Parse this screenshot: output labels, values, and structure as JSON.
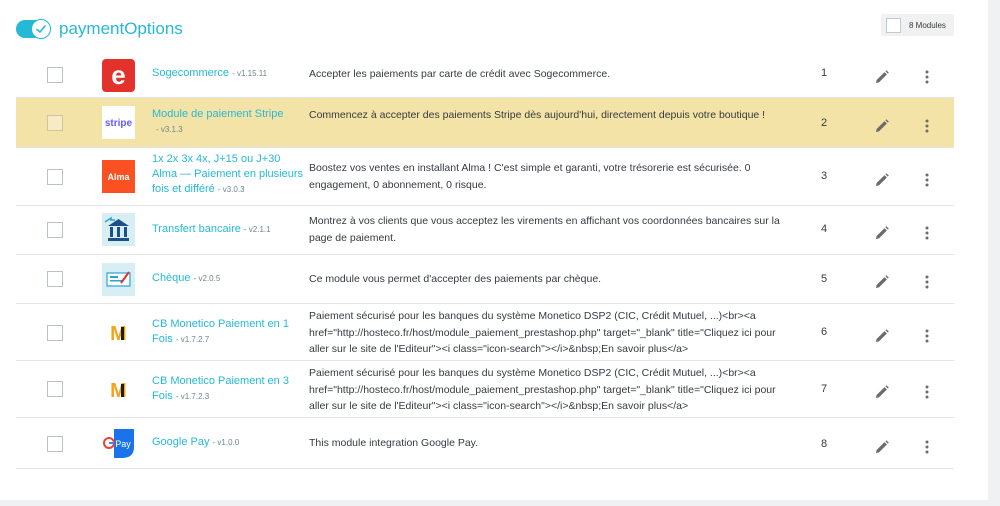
{
  "hook": {
    "title": "paymentOptions",
    "modules_count_label": "8 Modules",
    "toggle_on": true,
    "accent_color": "#25b9d7"
  },
  "modules": [
    {
      "name": "Sogecommerce",
      "version": "- v1.15.11",
      "description": "Accepter les paiements par carte de crédit avec Sogecommerce.",
      "position": "1",
      "logo": "sogecommerce-logo"
    },
    {
      "name": "Module de paiement Stripe",
      "version": "- v3.1.3",
      "description": "Commencez à accepter des paiements Stripe dès aujourd'hui, directement depuis votre boutique !",
      "position": "2",
      "logo": "stripe-logo",
      "logo_text": "stripe"
    },
    {
      "name": "1x 2x 3x 4x, J+15 ou J+30 Alma — Paiement en plusieurs fois et différé",
      "version": "- v3.0.3",
      "description": "Boostez vos ventes en installant Alma ! C'est simple et garanti, votre trésorerie est sécurisée. 0 engagement, 0 abonnement, 0 risque.",
      "position": "3",
      "logo": "alma-logo",
      "logo_text": "Alma"
    },
    {
      "name": "Transfert bancaire",
      "version": "- v2.1.1",
      "description": "Montrez à vos clients que vous acceptez les virements en affichant vos coordonnées bancaires sur la page de paiement.",
      "position": "4",
      "logo": "bank-transfer-logo"
    },
    {
      "name": "Chèque",
      "version": "- v2.0.5",
      "description": "Ce module vous permet d'accepter des paiements par chèque.",
      "position": "5",
      "logo": "cheque-logo"
    },
    {
      "name": "CB Monetico Paiement en 1 Fois",
      "version": "- v1.7.2.7",
      "description": "Paiement sécurisé pour les banques du système Monetico DSP2 (CIC, Crédit Mutuel, ...)<br><a href=\"http://hosteco.fr/host/module_paiement_prestashop.php\" target=\"_blank\" title=\"Cliquez ici pour aller sur le site de l'Editeur\"><i class=\"icon-search\"></i>&nbsp;En savoir plus</a>",
      "position": "6",
      "logo": "monetico-logo",
      "logo_text": "M"
    },
    {
      "name": "CB Monetico Paiement en 3 Fois",
      "version": "- v1.7.2.3",
      "description": "Paiement sécurisé pour les banques du système Monetico DSP2 (CIC, Crédit Mutuel, ...)<br><a href=\"http://hosteco.fr/host/module_paiement_prestashop.php\" target=\"_blank\" title=\"Cliquez ici pour aller sur le site de l'Editeur\"><i class=\"icon-search\"></i>&nbsp;En savoir plus</a>",
      "position": "7",
      "logo": "monetico-logo",
      "logo_text": "M"
    },
    {
      "name": "Google Pay",
      "version": "- v1.0.0",
      "description": "This module integration Google Pay.",
      "position": "8",
      "logo": "google-pay-logo",
      "logo_text": "Pay"
    }
  ]
}
